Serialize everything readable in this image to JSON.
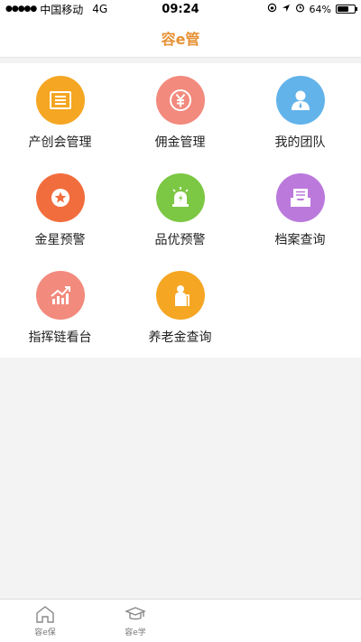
{
  "status_bar": {
    "signal": "●●●●●",
    "carrier": "中国移动",
    "network": "4G",
    "time": "09:24",
    "battery_text": "64%",
    "battery_level": 0.64
  },
  "header": {
    "title": "容e管"
  },
  "grid": {
    "items": [
      {
        "label": "产创会管理",
        "color": "#f5a623",
        "icon": "certificate-icon"
      },
      {
        "label": "佣金管理",
        "color": "#f28a7d",
        "icon": "yen-coin-icon"
      },
      {
        "label": "我的团队",
        "color": "#62b3ea",
        "icon": "team-user-icon"
      },
      {
        "label": "金星预警",
        "color": "#f26d3d",
        "icon": "star-badge-icon"
      },
      {
        "label": "品优预警",
        "color": "#7cc743",
        "icon": "alarm-light-icon"
      },
      {
        "label": "档案查询",
        "color": "#bb79dc",
        "icon": "archive-inbox-icon"
      },
      {
        "label": "指挥链看台",
        "color": "#f28a7d",
        "icon": "trend-chart-icon"
      },
      {
        "label": "养老金查询",
        "color": "#f5a623",
        "icon": "elderly-person-icon"
      }
    ]
  },
  "tab_bar": {
    "tabs": [
      {
        "label": "容e保",
        "icon": "home-icon"
      },
      {
        "label": "容e学",
        "icon": "graduation-cap-icon"
      }
    ]
  }
}
